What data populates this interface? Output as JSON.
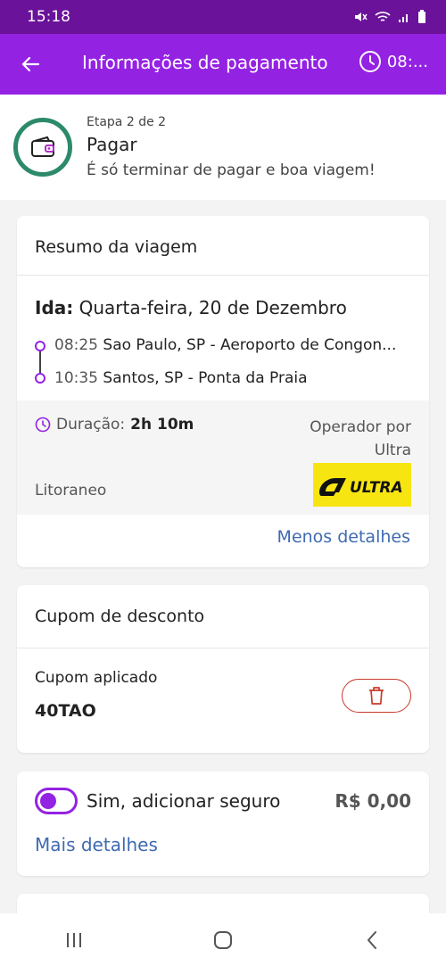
{
  "status_bar": {
    "time": "15:18"
  },
  "app_bar": {
    "title": "Informações de pagamento",
    "timer": "08:..."
  },
  "step": {
    "counter": "Etapa 2 de 2",
    "title": "Pagar",
    "subtitle": "É só terminar de pagar e boa viagem!"
  },
  "trip": {
    "heading": "Resumo da viagem",
    "direction": "Ida:",
    "date": " Quarta-feira, 20 de Dezembro",
    "stops": [
      {
        "time": "08:25",
        "place": " Sao Paulo, SP - Aeroporto de Congon..."
      },
      {
        "time": "10:35",
        "place": " Santos, SP - Ponta da Praia"
      }
    ],
    "duration_label": "Duração:",
    "duration_value": "2h 10m",
    "operator_label": "Operador por Ultra",
    "company": "Litoraneo",
    "logo_text": "ULTRA",
    "less_details": "Menos detalhes"
  },
  "coupon": {
    "heading": "Cupom de desconto",
    "label": "Cupom aplicado",
    "code": "40TAO"
  },
  "insurance": {
    "label": "Sim, adicionar seguro",
    "price": "R$ 0,00",
    "more_details": "Mais detalhes"
  },
  "colors": {
    "status_bar": "#6a1299",
    "app_bar": "#9422e3",
    "step_ring": "#2c8a6a",
    "link": "#3f6ab0",
    "delete": "#c83a2b",
    "logo_bg": "#f7e511"
  }
}
